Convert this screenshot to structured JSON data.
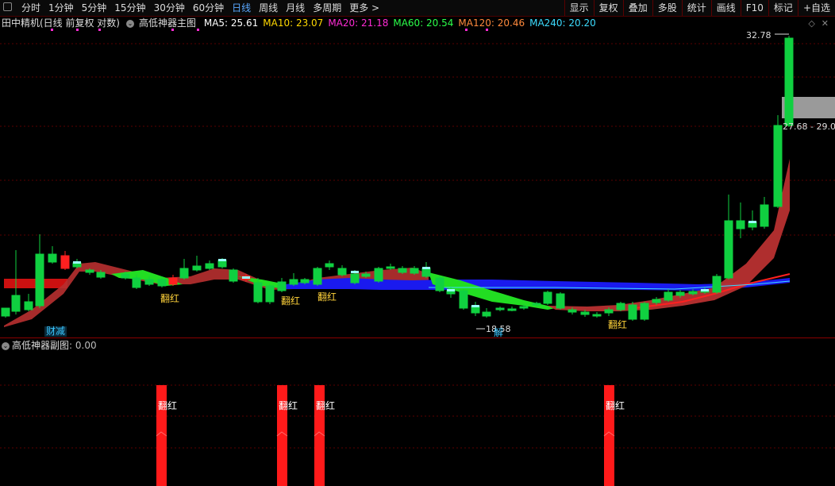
{
  "toolbar": {
    "periods": [
      "分时",
      "1分钟",
      "5分钟",
      "15分钟",
      "30分钟",
      "60分钟",
      "日线",
      "周线",
      "月线",
      "多周期",
      "更多"
    ],
    "active_period": "日线",
    "more_arrow": ">",
    "right_tools": [
      "显示",
      "复权",
      "叠加",
      "多股",
      "统计",
      "画线",
      "F10",
      "标记",
      "+自选"
    ]
  },
  "info": {
    "stock": "田中精机(日线 前复权 对数)",
    "indicator": "高低神器主图",
    "ma": [
      {
        "label": "MA5: 25.61",
        "color": "#ffffff"
      },
      {
        "label": "MA10: 23.07",
        "color": "#ffd800"
      },
      {
        "label": "MA20: 21.18",
        "color": "#ff2bd5"
      },
      {
        "label": "MA60: 20.54",
        "color": "#2bff4a"
      },
      {
        "label": "MA120: 20.46",
        "color": "#ff8a3d"
      },
      {
        "label": "MA240: 20.20",
        "color": "#3cdcff"
      }
    ]
  },
  "main_chart": {
    "high_label": "32.78",
    "range_label": "27.68 - 29.0",
    "low_label": "18.58",
    "signals": [
      {
        "text": "财减",
        "color": "#39c6ff"
      },
      {
        "text": "翻红",
        "color": "#ffd23a"
      },
      {
        "text": "翻红",
        "color": "#ffd23a"
      },
      {
        "text": "翻红",
        "color": "#ffd23a"
      },
      {
        "text": "解",
        "color": "#39c6ff"
      },
      {
        "text": "翻红",
        "color": "#ffd23a"
      }
    ]
  },
  "sub_chart": {
    "title": "高低神器副图",
    "value": ": 0.00",
    "bar_label": "翻红"
  },
  "colors": {
    "up": "#ff2020",
    "down": "#10d040",
    "grid": "#5a0000",
    "active": "#5aa8ff"
  }
}
